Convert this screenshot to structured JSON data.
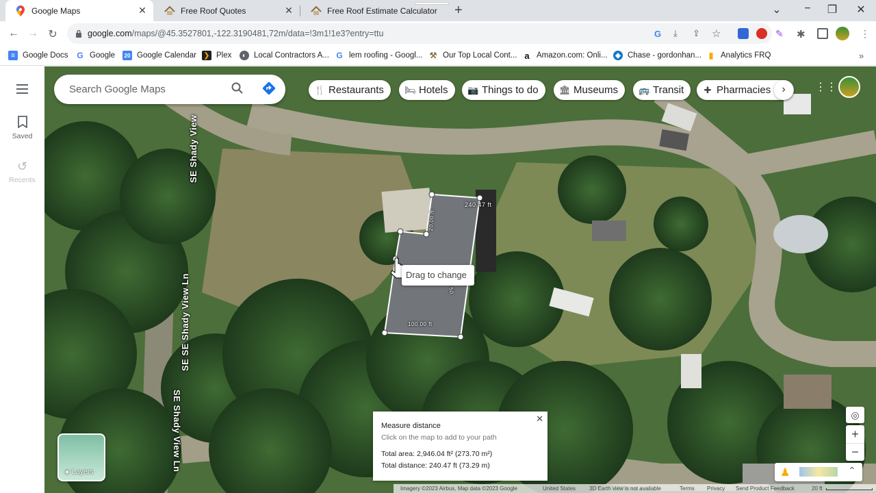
{
  "browser": {
    "tabs": [
      {
        "title": "Google Maps",
        "active": true,
        "icon": "google-maps-pin-icon"
      },
      {
        "title": "Free Roof Quotes",
        "active": false,
        "icon": "roof-icon"
      },
      {
        "title": "Free Roof Estimate Calculator",
        "active": false,
        "icon": "roof-icon"
      }
    ],
    "url_main": "google.com",
    "url_rest": "/maps/@45.3527801,-122.3190481,72m/data=!3m1!1e3?entry=ttu",
    "bookmarks": [
      {
        "label": "Google Docs",
        "icon": "docs-icon",
        "color": "#4285f4",
        "glyph": "≡"
      },
      {
        "label": "Google",
        "icon": "google-icon",
        "color": "#ffffff",
        "glyph": "G"
      },
      {
        "label": "Google Calendar",
        "icon": "calendar-icon",
        "color": "#4285f4",
        "glyph": "20"
      },
      {
        "label": "Plex",
        "icon": "plex-icon",
        "color": "#1f1f1f",
        "glyph": "❯"
      },
      {
        "label": "Local Contractors A...",
        "icon": "globe-icon",
        "color": "#5f6368",
        "glyph": "◐"
      },
      {
        "label": "lem roofing - Googl...",
        "icon": "google-icon",
        "color": "#ffffff",
        "glyph": "G"
      },
      {
        "label": "Our Top Local Cont...",
        "icon": "hammer-icon",
        "color": "#8a6d3b",
        "glyph": "⚒"
      },
      {
        "label": "Amazon.com: Onli...",
        "icon": "amazon-icon",
        "color": "#ffffff",
        "glyph": "a"
      },
      {
        "label": "Chase - gordonhan...",
        "icon": "chase-icon",
        "color": "#117aca",
        "glyph": "◆"
      },
      {
        "label": "Analytics FRQ",
        "icon": "analytics-icon",
        "color": "#f9ab00",
        "glyph": "▮"
      }
    ]
  },
  "maps": {
    "search_placeholder": "Search Google Maps",
    "rail": {
      "saved": "Saved",
      "recents": "Recents"
    },
    "chips": [
      {
        "label": "Restaurants",
        "icon": "fork-knife-icon",
        "glyph": "🍴"
      },
      {
        "label": "Hotels",
        "icon": "bed-icon",
        "glyph": "🛏"
      },
      {
        "label": "Things to do",
        "icon": "camera-icon",
        "glyph": "📷"
      },
      {
        "label": "Museums",
        "icon": "museum-icon",
        "glyph": "🏛"
      },
      {
        "label": "Transit",
        "icon": "bus-icon",
        "glyph": "🚌"
      },
      {
        "label": "Pharmacies",
        "icon": "pill-icon",
        "glyph": "✚"
      }
    ],
    "street_label": "SE Shady View Ln",
    "street_label_b": "SE Shady View",
    "street_label_c": "SE SE Shady View Ln",
    "edge_labels": {
      "top": "240.47 ft",
      "short": "20.00 ft",
      "bottom": "100.00 ft",
      "right": "50"
    },
    "tooltip": "Drag to change",
    "measure": {
      "title": "Measure distance",
      "subtitle": "Click on the map to add to your path",
      "total_area": "Total area: 2,946.04 ft² (273.70 m²)",
      "total_distance": "Total distance: 240.47 ft (73.29 m)"
    },
    "layers_label": "Layers",
    "footer": {
      "imagery": "Imagery ©2023 Airbus, Map data ©2023 Google",
      "country": "United States",
      "earth": "3D Earth view is not available",
      "terms": "Terms",
      "privacy": "Privacy",
      "feedback": "Send Product Feedback",
      "scale": "20 ft"
    }
  }
}
